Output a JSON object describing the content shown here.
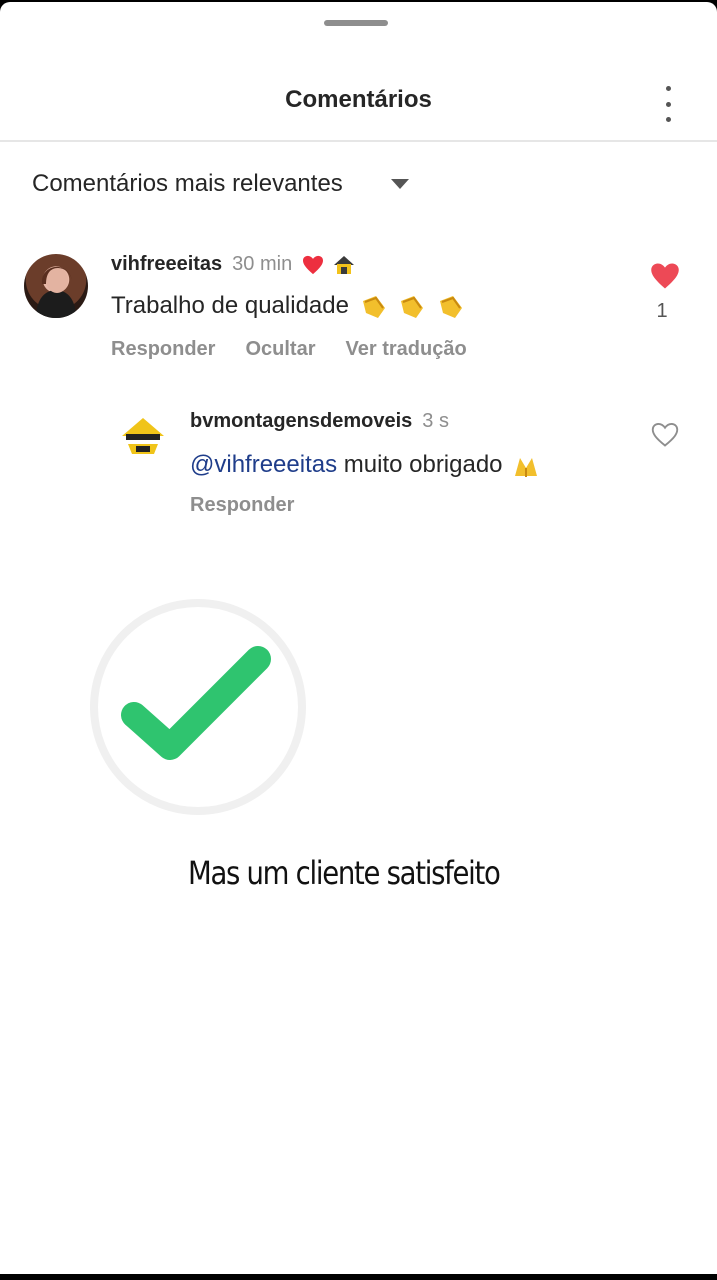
{
  "sheet": {
    "title": "Comentários"
  },
  "sort": {
    "label": "Comentários mais relevantes"
  },
  "comments": [
    {
      "username": "vihfreeeitas",
      "time": "30 min",
      "text": "Trabalho de qualidade",
      "actions": [
        "Responder",
        "Ocultar",
        "Ver tradução"
      ],
      "likes": "1",
      "liked": true
    }
  ],
  "reply": {
    "username": "bvmontagensdemoveis",
    "time": "3 s",
    "mention": "@vihfreeeitas",
    "text": "muito obrigado",
    "action": "Responder"
  },
  "overlay": {
    "caption": "Mas um cliente satisfeito"
  },
  "colors": {
    "like_red": "#ed4956",
    "check_green": "#2fc46f",
    "mention_blue": "#1f3d8a"
  },
  "icons": [
    "more-icon",
    "chevron-down-icon",
    "heart-icon",
    "house-icon",
    "clap-icon",
    "heart-outline-icon",
    "check-icon"
  ]
}
